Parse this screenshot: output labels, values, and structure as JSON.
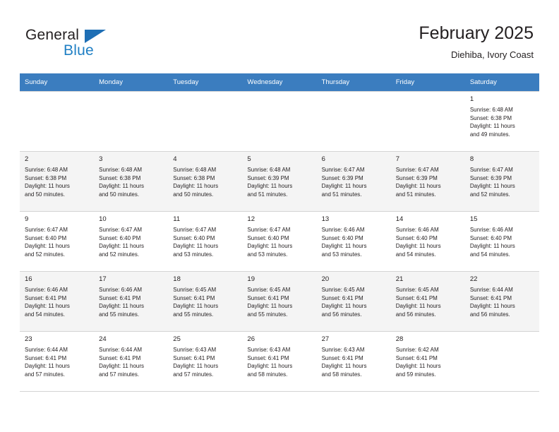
{
  "brand": {
    "name_top": "General",
    "name_bottom": "Blue",
    "triangle_color": "#1f6fb5",
    "blue_text_color": "#1f7fc4"
  },
  "header": {
    "title": "February 2025",
    "subtitle": "Diehiba, Ivory Coast"
  },
  "colors": {
    "header_row_bg": "#3b7dbf",
    "header_row_text": "#ffffff",
    "shaded_row_bg": "#f4f4f4",
    "grid_line": "#d4d4d4",
    "text": "#231f20"
  },
  "weekday_headers": [
    "Sunday",
    "Monday",
    "Tuesday",
    "Wednesday",
    "Thursday",
    "Friday",
    "Saturday"
  ],
  "weeks": [
    {
      "shaded": false,
      "days": [
        {
          "empty": true,
          "number": "",
          "info": ""
        },
        {
          "empty": true,
          "number": "",
          "info": ""
        },
        {
          "empty": true,
          "number": "",
          "info": ""
        },
        {
          "empty": true,
          "number": "",
          "info": ""
        },
        {
          "empty": true,
          "number": "",
          "info": ""
        },
        {
          "empty": true,
          "number": "",
          "info": ""
        },
        {
          "empty": false,
          "number": "1",
          "info": "Sunrise: 6:48 AM\nSunset: 6:38 PM\nDaylight: 11 hours\nand 49 minutes."
        }
      ]
    },
    {
      "shaded": true,
      "days": [
        {
          "empty": false,
          "number": "2",
          "info": "Sunrise: 6:48 AM\nSunset: 6:38 PM\nDaylight: 11 hours\nand 50 minutes."
        },
        {
          "empty": false,
          "number": "3",
          "info": "Sunrise: 6:48 AM\nSunset: 6:38 PM\nDaylight: 11 hours\nand 50 minutes."
        },
        {
          "empty": false,
          "number": "4",
          "info": "Sunrise: 6:48 AM\nSunset: 6:38 PM\nDaylight: 11 hours\nand 50 minutes."
        },
        {
          "empty": false,
          "number": "5",
          "info": "Sunrise: 6:48 AM\nSunset: 6:39 PM\nDaylight: 11 hours\nand 51 minutes."
        },
        {
          "empty": false,
          "number": "6",
          "info": "Sunrise: 6:47 AM\nSunset: 6:39 PM\nDaylight: 11 hours\nand 51 minutes."
        },
        {
          "empty": false,
          "number": "7",
          "info": "Sunrise: 6:47 AM\nSunset: 6:39 PM\nDaylight: 11 hours\nand 51 minutes."
        },
        {
          "empty": false,
          "number": "8",
          "info": "Sunrise: 6:47 AM\nSunset: 6:39 PM\nDaylight: 11 hours\nand 52 minutes."
        }
      ]
    },
    {
      "shaded": false,
      "days": [
        {
          "empty": false,
          "number": "9",
          "info": "Sunrise: 6:47 AM\nSunset: 6:40 PM\nDaylight: 11 hours\nand 52 minutes."
        },
        {
          "empty": false,
          "number": "10",
          "info": "Sunrise: 6:47 AM\nSunset: 6:40 PM\nDaylight: 11 hours\nand 52 minutes."
        },
        {
          "empty": false,
          "number": "11",
          "info": "Sunrise: 6:47 AM\nSunset: 6:40 PM\nDaylight: 11 hours\nand 53 minutes."
        },
        {
          "empty": false,
          "number": "12",
          "info": "Sunrise: 6:47 AM\nSunset: 6:40 PM\nDaylight: 11 hours\nand 53 minutes."
        },
        {
          "empty": false,
          "number": "13",
          "info": "Sunrise: 6:46 AM\nSunset: 6:40 PM\nDaylight: 11 hours\nand 53 minutes."
        },
        {
          "empty": false,
          "number": "14",
          "info": "Sunrise: 6:46 AM\nSunset: 6:40 PM\nDaylight: 11 hours\nand 54 minutes."
        },
        {
          "empty": false,
          "number": "15",
          "info": "Sunrise: 6:46 AM\nSunset: 6:40 PM\nDaylight: 11 hours\nand 54 minutes."
        }
      ]
    },
    {
      "shaded": true,
      "days": [
        {
          "empty": false,
          "number": "16",
          "info": "Sunrise: 6:46 AM\nSunset: 6:41 PM\nDaylight: 11 hours\nand 54 minutes."
        },
        {
          "empty": false,
          "number": "17",
          "info": "Sunrise: 6:46 AM\nSunset: 6:41 PM\nDaylight: 11 hours\nand 55 minutes."
        },
        {
          "empty": false,
          "number": "18",
          "info": "Sunrise: 6:45 AM\nSunset: 6:41 PM\nDaylight: 11 hours\nand 55 minutes."
        },
        {
          "empty": false,
          "number": "19",
          "info": "Sunrise: 6:45 AM\nSunset: 6:41 PM\nDaylight: 11 hours\nand 55 minutes."
        },
        {
          "empty": false,
          "number": "20",
          "info": "Sunrise: 6:45 AM\nSunset: 6:41 PM\nDaylight: 11 hours\nand 56 minutes."
        },
        {
          "empty": false,
          "number": "21",
          "info": "Sunrise: 6:45 AM\nSunset: 6:41 PM\nDaylight: 11 hours\nand 56 minutes."
        },
        {
          "empty": false,
          "number": "22",
          "info": "Sunrise: 6:44 AM\nSunset: 6:41 PM\nDaylight: 11 hours\nand 56 minutes."
        }
      ]
    },
    {
      "shaded": false,
      "days": [
        {
          "empty": false,
          "number": "23",
          "info": "Sunrise: 6:44 AM\nSunset: 6:41 PM\nDaylight: 11 hours\nand 57 minutes."
        },
        {
          "empty": false,
          "number": "24",
          "info": "Sunrise: 6:44 AM\nSunset: 6:41 PM\nDaylight: 11 hours\nand 57 minutes."
        },
        {
          "empty": false,
          "number": "25",
          "info": "Sunrise: 6:43 AM\nSunset: 6:41 PM\nDaylight: 11 hours\nand 57 minutes."
        },
        {
          "empty": false,
          "number": "26",
          "info": "Sunrise: 6:43 AM\nSunset: 6:41 PM\nDaylight: 11 hours\nand 58 minutes."
        },
        {
          "empty": false,
          "number": "27",
          "info": "Sunrise: 6:43 AM\nSunset: 6:41 PM\nDaylight: 11 hours\nand 58 minutes."
        },
        {
          "empty": false,
          "number": "28",
          "info": "Sunrise: 6:42 AM\nSunset: 6:41 PM\nDaylight: 11 hours\nand 59 minutes."
        },
        {
          "empty": true,
          "number": "",
          "info": ""
        }
      ]
    }
  ]
}
